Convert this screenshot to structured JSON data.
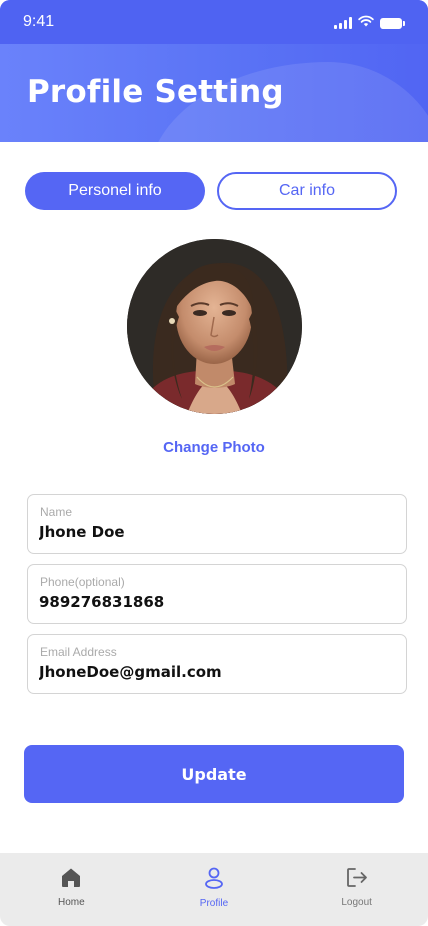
{
  "status_bar": {
    "time": "9:41",
    "icons": [
      "signal-icon",
      "wifi-icon",
      "battery-icon"
    ]
  },
  "header": {
    "title": "Profile Setting"
  },
  "tabs": [
    {
      "label": "Personel info",
      "active": true
    },
    {
      "label": "Car info",
      "active": false
    }
  ],
  "profile": {
    "change_photo_label": "Change Photo"
  },
  "form": {
    "name": {
      "label": "Name",
      "value": "Jhone Doe"
    },
    "phone": {
      "label": "Phone(optional)",
      "value": "989276831868"
    },
    "email": {
      "label": "Email Address",
      "value": "JhoneDoe@gmail.com"
    }
  },
  "actions": {
    "update_label": "Update"
  },
  "bottom_nav": [
    {
      "label": "Home",
      "icon": "home-icon",
      "active": false
    },
    {
      "label": "Profile",
      "icon": "user-icon",
      "active": true
    },
    {
      "label": "Logout",
      "icon": "logout-icon",
      "active": false
    }
  ],
  "colors": {
    "accent": "#5566f4",
    "header_start": "#6a82fb",
    "status_bar": "#4f63f2",
    "nav_background": "#ebebeb",
    "field_border": "#d4d4d4"
  }
}
